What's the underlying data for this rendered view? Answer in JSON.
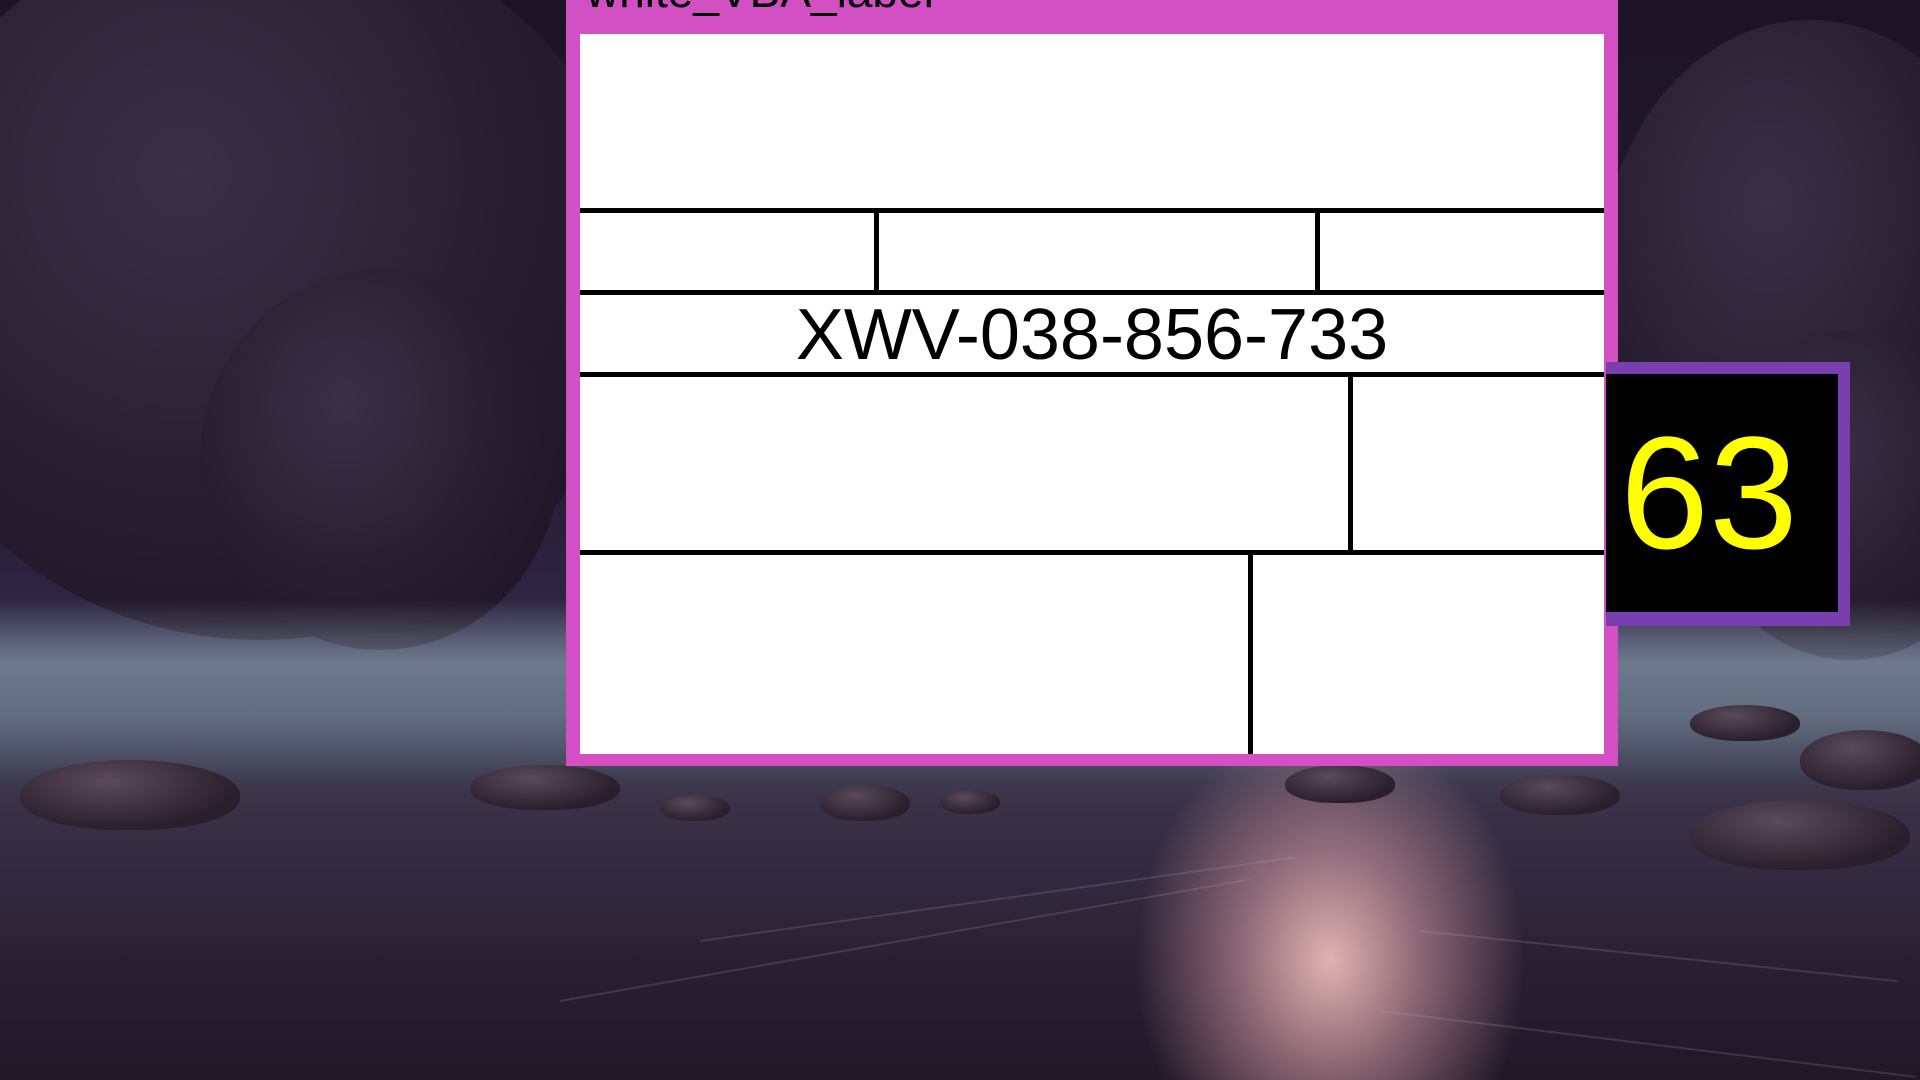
{
  "window": {
    "title": "white_VBA_label"
  },
  "label": {
    "tracking_code": "XWV-038-856-733"
  },
  "badge": {
    "value": "63"
  },
  "colors": {
    "window_frame": "#d24fc4",
    "badge_frame": "#7a3fae",
    "badge_background": "#000000",
    "badge_text": "#ffff00",
    "sheet_background": "#ffffff"
  },
  "background": {
    "description_icon": "night-beach-wallpaper"
  }
}
